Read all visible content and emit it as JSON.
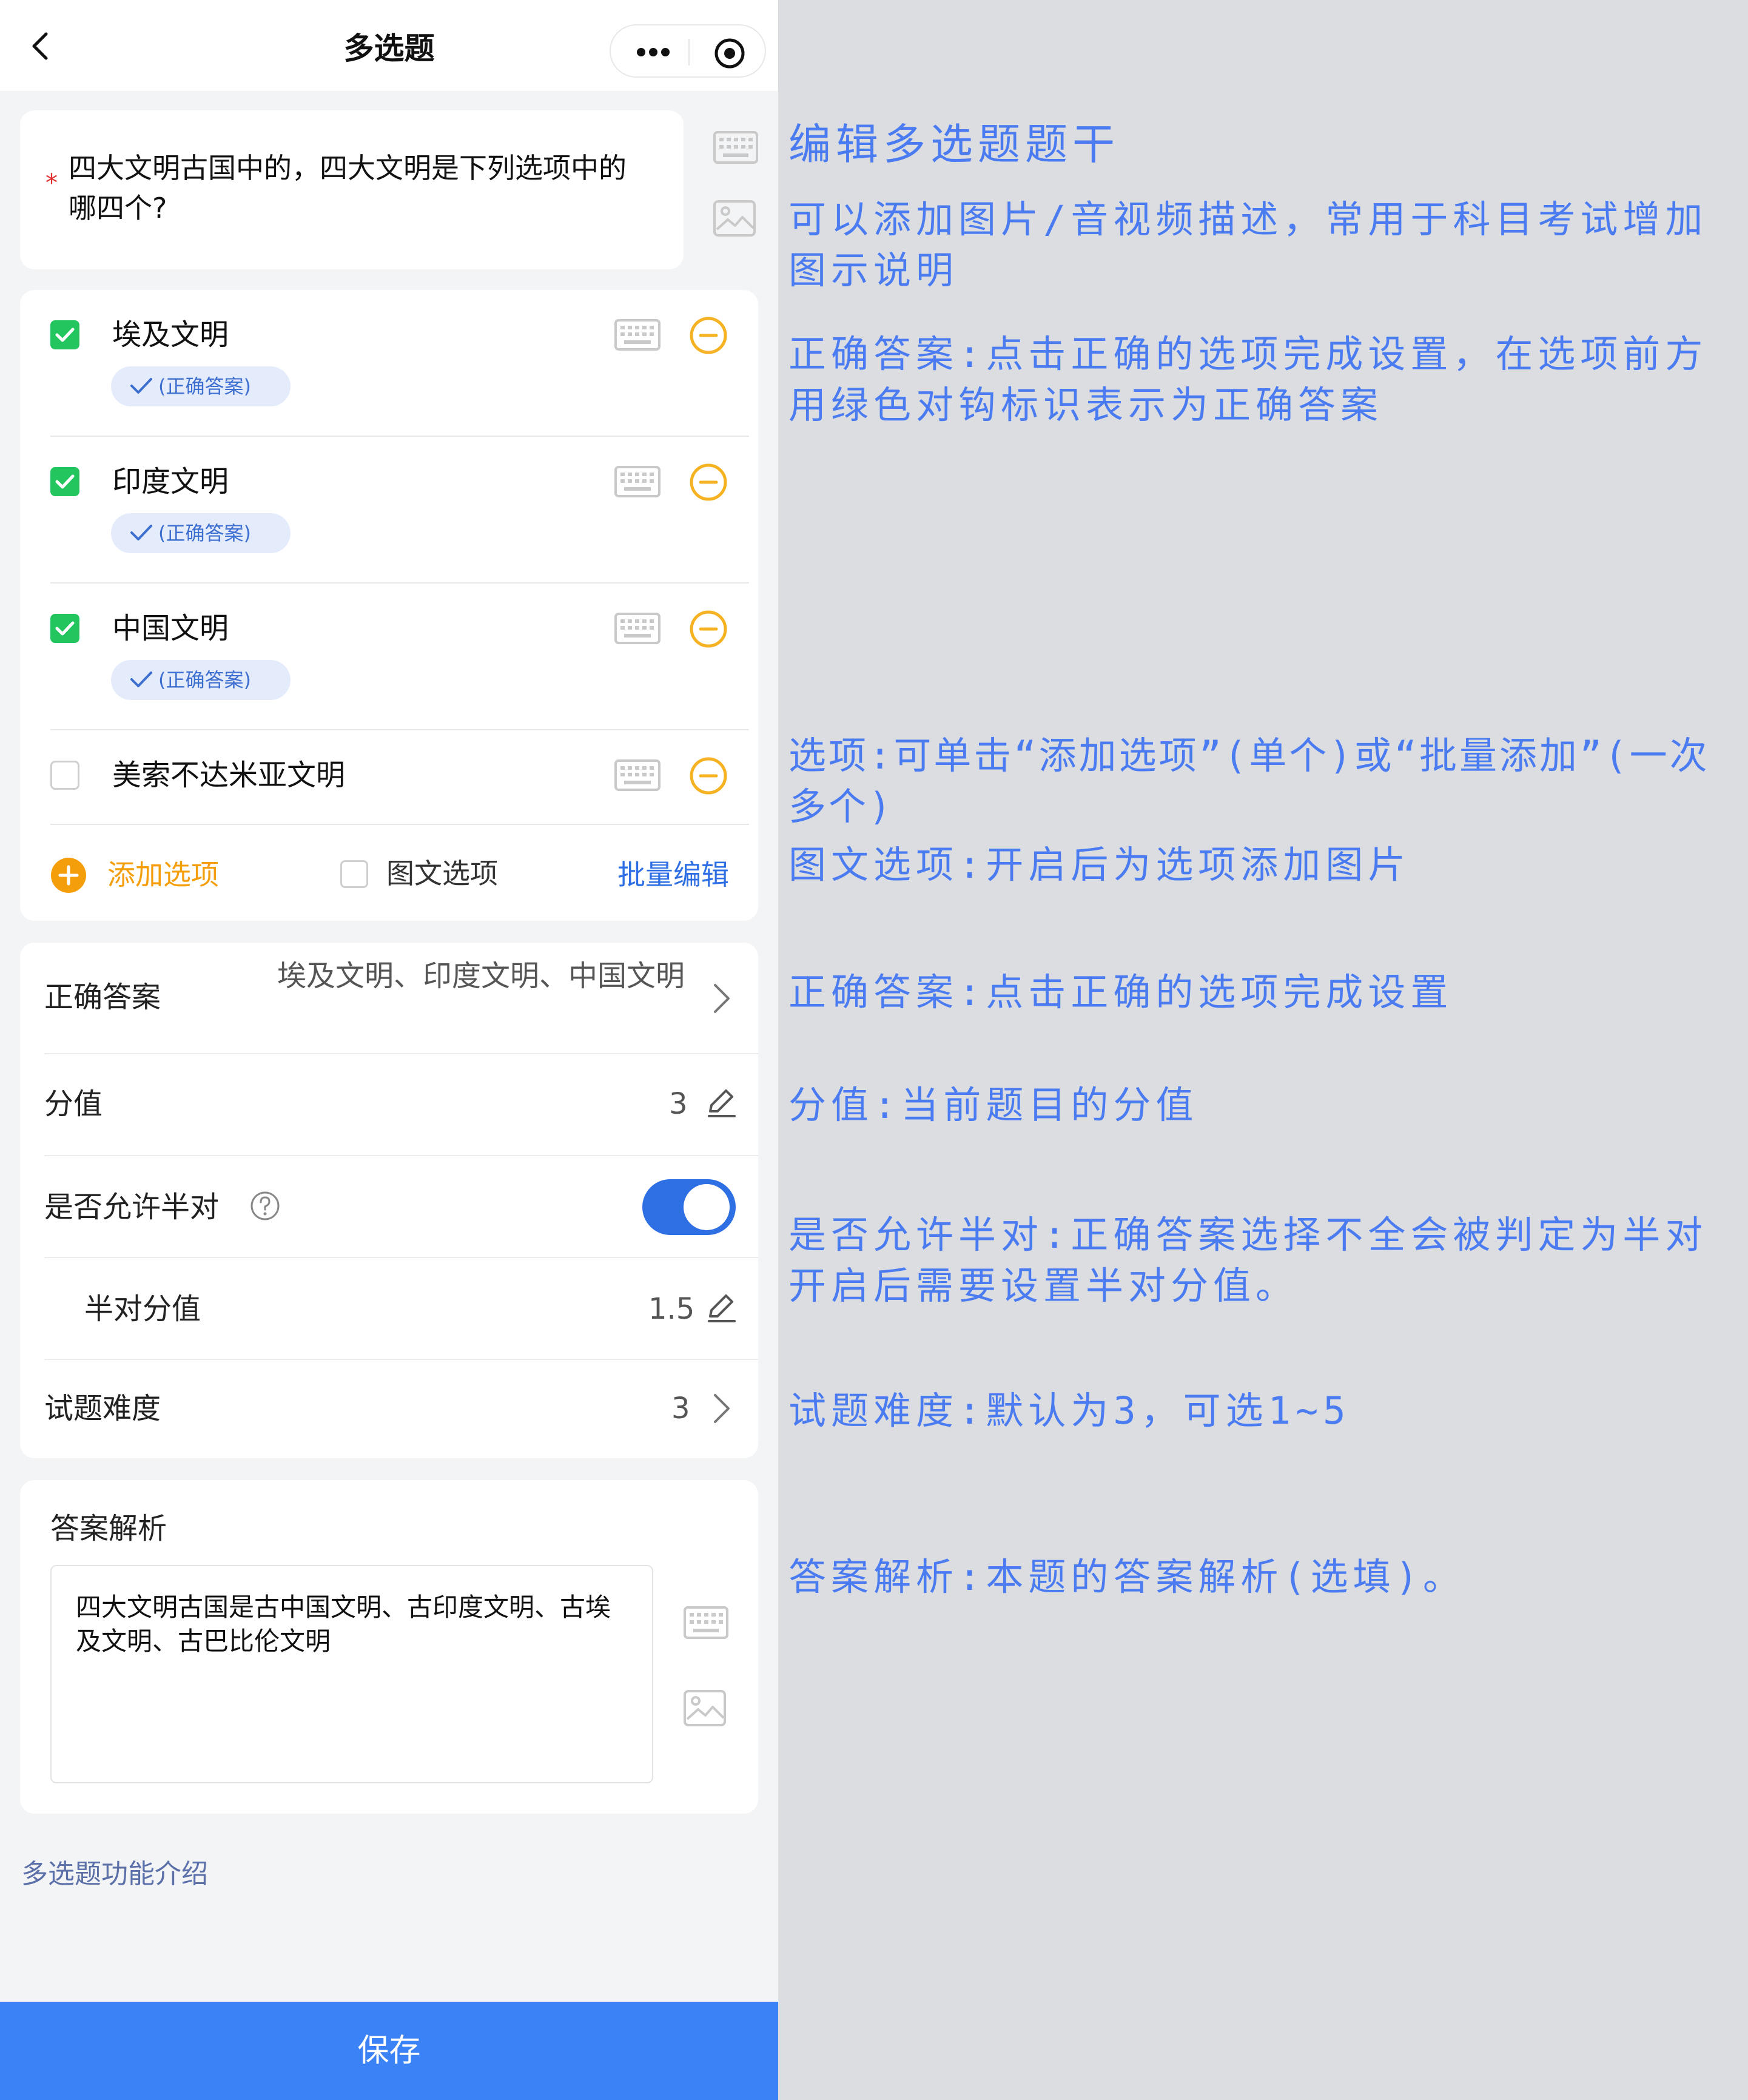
{
  "nav": {
    "title": "多选题"
  },
  "question": {
    "required_mark": "*",
    "text": "四大文明古国中的，四大文明是下列选项中的哪四个?"
  },
  "options": [
    {
      "label": "埃及文明",
      "checked": true,
      "badge": "(正确答案)"
    },
    {
      "label": "印度文明",
      "checked": true,
      "badge": "(正确答案)"
    },
    {
      "label": "中国文明",
      "checked": true,
      "badge": "(正确答案)"
    },
    {
      "label": "美索不达米亚文明",
      "checked": false,
      "badge": ""
    }
  ],
  "option_actions": {
    "add_label": "添加选项",
    "image_option_label": "图文选项",
    "batch_edit_label": "批量编辑"
  },
  "settings": {
    "correct_answer": {
      "label": "正确答案",
      "value": "埃及文明、印度文明、中国文明"
    },
    "score": {
      "label": "分值",
      "value": "3"
    },
    "half": {
      "label": "是否允许半对",
      "enabled": true
    },
    "half_score": {
      "label": "半对分值",
      "value": "1.5"
    },
    "difficulty": {
      "label": "试题难度",
      "value": "3"
    }
  },
  "analysis": {
    "title": "答案解析",
    "text": "四大文明古国是古中国文明、古印度文明、古埃及文明、古巴比伦文明"
  },
  "intro_link": "多选题功能介绍",
  "save_label": "保存",
  "annotations": {
    "edit_stem": "编辑多选题题干",
    "media": "可以添加图片/音视频描述，常用于科目考试增加图示说明",
    "correct_setting": "正确答案:点击正确的选项完成设置，在选项前方用绿色对钩标识表示为正确答案",
    "options": "选项:可单击“添加选项”(单个)或“批量添加”(一次多个)",
    "image_option": "图文选项:开启后为选项添加图片",
    "correct_short": "正确答案:点击正确的选项完成设置",
    "score": "分值:当前题目的分值",
    "half": "是否允许半对:正确答案选择不全会被判定为半对开启后需要设置半对分值。",
    "difficulty": "试题难度:默认为3，可选1~5",
    "analysis": "答案解析:本题的答案解析(选填)。"
  },
  "colors": {
    "accent_blue": "#2f6fe4",
    "check_green": "#22c55e",
    "action_orange": "#f59e0b",
    "annotation_blue": "#4a7bf0"
  }
}
